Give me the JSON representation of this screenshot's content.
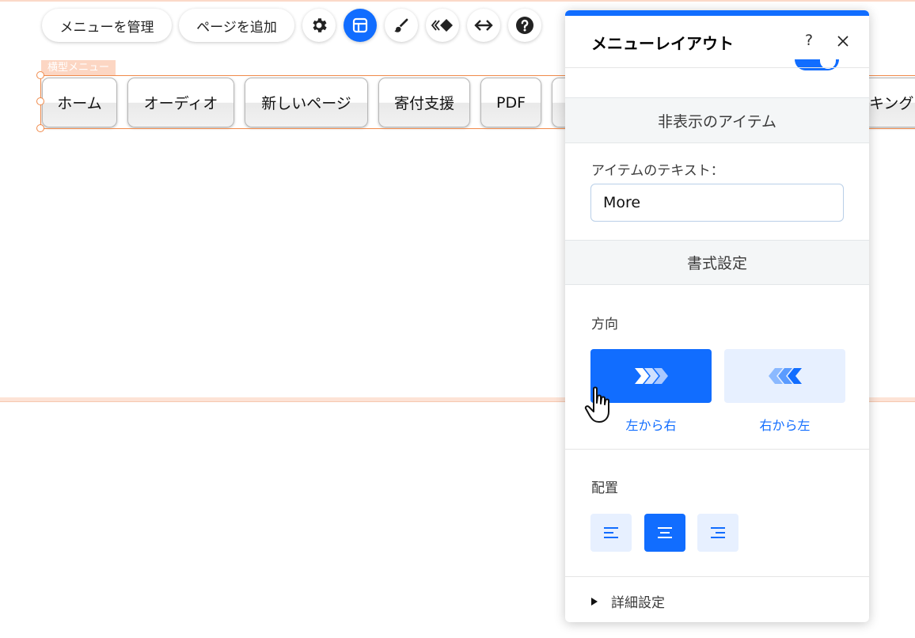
{
  "toolbar": {
    "manage_menu_label": "メニューを管理",
    "add_page_label": "ページを追加",
    "icons": [
      "gear-icon",
      "layout-icon",
      "paint-brush-icon",
      "animation-icon",
      "stretch-icon",
      "help-icon"
    ],
    "active_icon": "layout-icon"
  },
  "canvas": {
    "component_label": "横型メニュー",
    "menu_items": [
      "ホーム",
      "オーディオ",
      "新しいページ",
      "寄付支援",
      "PDF",
      "キング"
    ]
  },
  "panel": {
    "title": "メニューレイアウト",
    "help_label": "?",
    "hidden_items": {
      "header": "非表示のアイテム",
      "item_text_label": "アイテムのテキスト：",
      "item_text_value": "More"
    },
    "format": {
      "header": "書式設定",
      "direction_label": "方向",
      "direction_options": [
        "左から右",
        "右から左"
      ],
      "direction_selected": "左から右",
      "alignment_label": "配置",
      "alignment_options": [
        "align-left-icon",
        "align-center-icon",
        "align-right-icon"
      ],
      "alignment_selected": "align-center-icon"
    },
    "advanced_label": "詳細設定"
  },
  "colors": {
    "accent": "#116dff",
    "accent_light": "#e7f0ff",
    "selection": "#f08a4b"
  }
}
